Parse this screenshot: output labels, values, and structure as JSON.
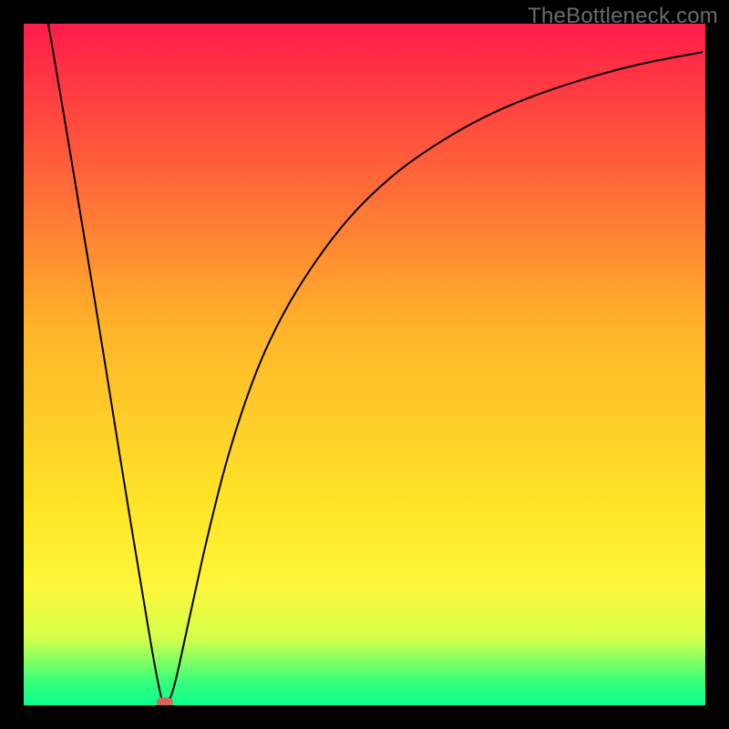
{
  "watermark": "TheBottleneck.com",
  "chart_data": {
    "type": "line",
    "title": "",
    "xlabel": "",
    "ylabel": "",
    "xlim": [
      0,
      100
    ],
    "ylim": [
      0,
      100
    ],
    "grid": false,
    "legend": false,
    "axes_visible": false,
    "background_gradient": {
      "stops": [
        {
          "pos": 0.0,
          "color": "#ff1b4a"
        },
        {
          "pos": 0.2,
          "color": "#ff5d3a"
        },
        {
          "pos": 0.45,
          "color": "#ffb52a"
        },
        {
          "pos": 0.7,
          "color": "#ffe326"
        },
        {
          "pos": 0.82,
          "color": "#fff63a"
        },
        {
          "pos": 0.9,
          "color": "#d8ff4a"
        },
        {
          "pos": 0.965,
          "color": "#38ff7a"
        },
        {
          "pos": 1.0,
          "color": "#09ff90"
        }
      ]
    },
    "series": [
      {
        "name": "curve",
        "color": "#000000",
        "width": 2,
        "x": [
          3.6,
          5,
          7,
          9,
          11,
          13,
          15,
          17,
          19,
          20.1,
          20.5,
          21,
          21.5,
          22,
          22.5,
          23.5,
          25,
          27,
          30,
          34,
          38,
          42,
          46,
          50,
          55,
          60,
          65,
          70,
          75,
          80,
          85,
          90,
          95,
          99.5
        ],
        "values": [
          100,
          92,
          80,
          68,
          56,
          43.5,
          31,
          19,
          7,
          1.3,
          0.3,
          0.3,
          1.0,
          2.5,
          4.5,
          9,
          16,
          25,
          37,
          49,
          57.5,
          64,
          69.5,
          74,
          78.5,
          82,
          85,
          87.5,
          89.5,
          91.2,
          92.7,
          94,
          95,
          95.8
        ]
      }
    ],
    "optimum_marker": {
      "shape": "rounded-rect",
      "x": 20.7,
      "y": 0.35,
      "color": "#d9645d",
      "width_units": 2.4,
      "height_units": 1.6
    },
    "frame": {
      "color": "#000000",
      "width": 26
    }
  }
}
